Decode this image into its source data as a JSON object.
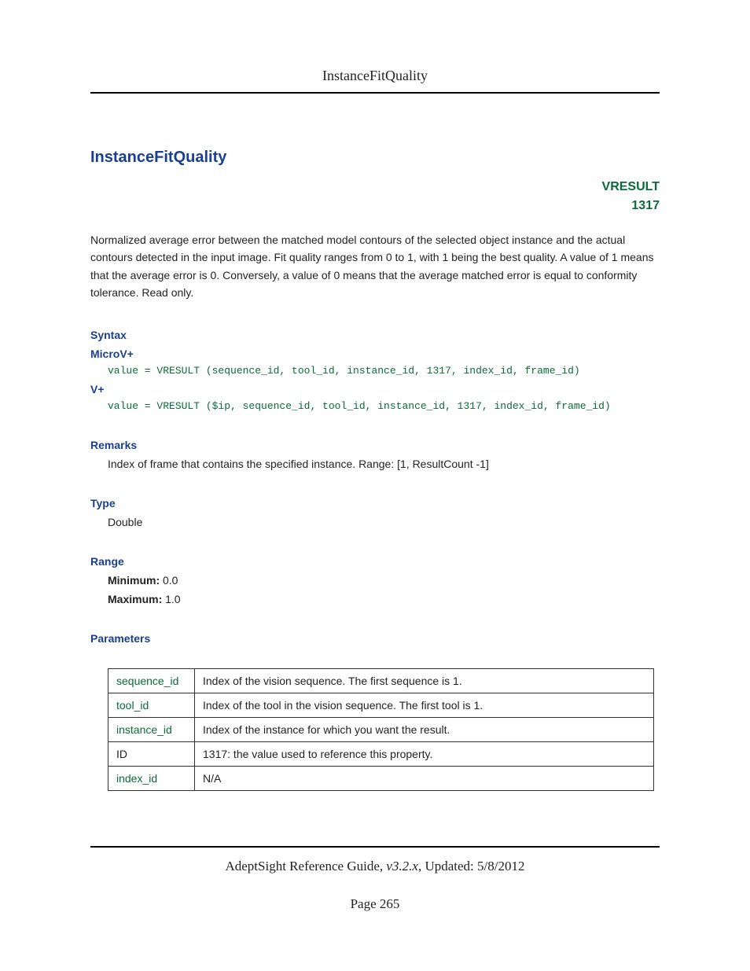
{
  "running_head": "InstanceFitQuality",
  "title": "InstanceFitQuality",
  "vresult": {
    "label": "VRESULT",
    "code": "1317"
  },
  "description": "Normalized average error between the matched model contours of the selected object instance and the actual contours detected in the input image. Fit quality ranges from 0 to 1, with 1 being the best quality. A value of 1 means that the average error is 0. Conversely, a value of 0 means that the average matched error is equal to conformity tolerance. Read only.",
  "syntax": {
    "heading": "Syntax",
    "microv": {
      "label": "MicroV+",
      "code": "value = VRESULT (sequence_id, tool_id, instance_id, 1317, index_id, frame_id)"
    },
    "vplus": {
      "label": "V+",
      "code": "value = VRESULT ($ip, sequence_id, tool_id, instance_id, 1317, index_id, frame_id)"
    }
  },
  "remarks": {
    "heading": "Remarks",
    "text": "Index of frame that contains the specified instance. Range: [1, ResultCount -1]"
  },
  "type": {
    "heading": "Type",
    "value": "Double"
  },
  "range": {
    "heading": "Range",
    "min_label": "Minimum:",
    "min_value": "0.0",
    "max_label": "Maximum:",
    "max_value": "1.0"
  },
  "parameters": {
    "heading": "Parameters",
    "rows": [
      {
        "name": "sequence_id",
        "desc": "Index of the vision sequence. The first sequence is 1."
      },
      {
        "name": "tool_id",
        "desc": "Index of the tool in the vision sequence. The first tool is 1."
      },
      {
        "name": "instance_id",
        "desc": "Index of the instance for which you want the result."
      },
      {
        "name": "ID",
        "desc": "1317: the value used to reference this property."
      },
      {
        "name": "index_id",
        "desc": "N/A"
      }
    ]
  },
  "footer": {
    "guide": "AdeptSight Reference Guide",
    "sep": ", ",
    "version": "v3.2.x",
    "updated_prefix": ", Updated: ",
    "updated": "5/8/2012",
    "page": "Page 265"
  }
}
